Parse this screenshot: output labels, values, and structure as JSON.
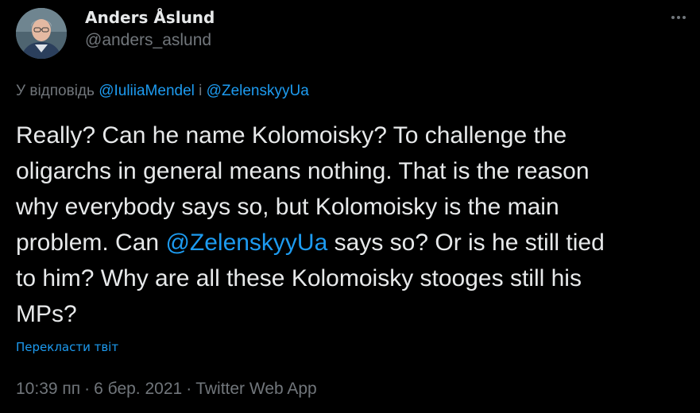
{
  "author": {
    "display_name": "Anders Åslund",
    "handle": "@anders_aslund"
  },
  "more_icon": "more-horizontal-icon",
  "reply": {
    "prefix": "У відповідь",
    "mention_1": "@IuliiaMendel",
    "conjunction": "і",
    "mention_2": "@ZelenskyyUa"
  },
  "body": {
    "line_1": "Really? Can he name Kolomoisky? To challenge the",
    "line_2": "oligarchs in general means nothing. That is the reason",
    "line_3": "why everybody says so, but Kolomoisky is the main",
    "line_4_before": "problem. Can ",
    "line_4_mention": "@ZelenskyyUa",
    "line_4_after": " says so? Or is he still tied",
    "line_5": "to him? Why are all these Kolomoisky stooges still his",
    "line_6": "MPs?"
  },
  "translate_label": "Перекласти твіт",
  "meta": {
    "time": "10:39 пп",
    "separator": "·",
    "date": "6 бер. 2021",
    "source": "Twitter Web App"
  },
  "colors": {
    "background": "#000000",
    "text": "#e7e9ea",
    "secondary": "#71767b",
    "accent": "#1d9bf0"
  }
}
